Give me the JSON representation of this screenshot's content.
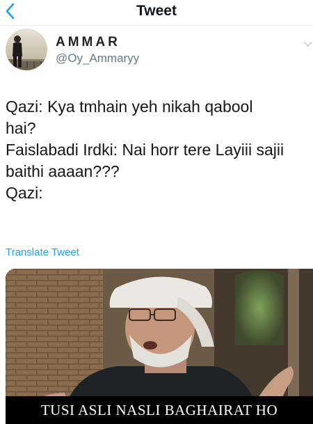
{
  "nav": {
    "title": "Tweet"
  },
  "author": {
    "display_name": "AMMAR",
    "handle": "@Oy_Ammaryy"
  },
  "tweet": {
    "lines": [
      "Qazi: Kya tmhain yeh nikah qabool",
      "hai?",
      "Faislabadi Irdki: Nai horr tere Layiii sajii",
      "baithi aaaan???",
      "Qazi:"
    ],
    "translate_label": "Translate Tweet"
  },
  "media": {
    "caption": "TUSI ASLI NASLI BAGHAIRAT HO"
  },
  "colors": {
    "accent": "#1da1f2",
    "secondary_text": "#657786",
    "divider": "#e6ecf0"
  }
}
